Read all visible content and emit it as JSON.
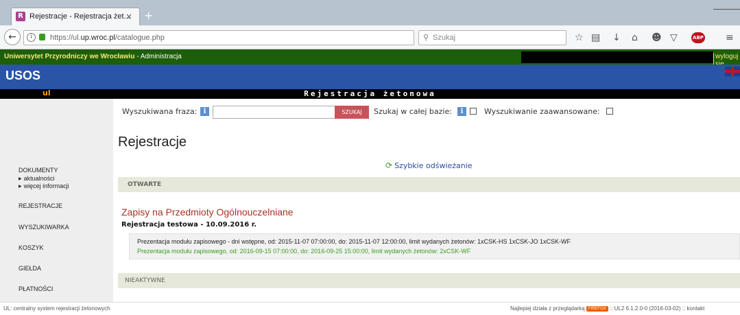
{
  "browser": {
    "tab_title": "Rejestracje - Rejestracja żet...",
    "tab_close": "×",
    "new_tab": "+",
    "favicon_letter": "R",
    "url_prefix": "https://ul.",
    "url_domain": "up.wroc.pl",
    "url_path": "/catalogue.php",
    "search_placeholder": "Szukaj"
  },
  "header": {
    "university": "Uniwersytet Przyrodniczy we Wrocławiu",
    "admin_link": " - Administracja",
    "logout": "wyloguj się",
    "logo": "USOS",
    "logo_sub": "ul",
    "page_banner": "Rejestracja żetonowa"
  },
  "sidebar": {
    "items": [
      {
        "label": "DOKUMENTY"
      },
      {
        "label": "aktualności"
      },
      {
        "label": "więcej informacji"
      },
      {
        "label": "REJESTRACJE"
      },
      {
        "label": "WYSZUKIWARKA"
      },
      {
        "label": "KOSZYK"
      },
      {
        "label": "GIEŁDA"
      },
      {
        "label": "PŁATNOŚCI"
      }
    ]
  },
  "search": {
    "label": "Wyszukiwana fraza:",
    "button": "SZUKAJ",
    "whole_db_label": "Szukaj w całej bazie:",
    "advanced_label": "Wyszukiwanie zaawansowane:",
    "info_glyph": "i"
  },
  "main": {
    "heading": "Rejestracje",
    "refresh_link": "Szybkie odświeżanie",
    "open_section": "OTWARTE",
    "registration_title": "Zapisy na Przedmioty Ogólnouczelniane",
    "registration_subtitle": "Rejestracja testowa - 10.09.2016 r.",
    "round1": "Prezentacja modułu zapisowego - dni wstępne, od: 2015-11-07 07:00:00, do: 2015-11-07 12:00:00, limit wydanych żetonów: 1xCSK-HS 1xCSK-JO 1xCSK-WF",
    "round2": "Prezentacja modułu zapisowego, od: 2016-09-15 07:00:00, do: 2016-09-25 15:00:00, limit wydanych żetonów: 2xCSK-WF",
    "inactive_section": "NIEAKTYWNE"
  },
  "footer": {
    "left": "UL: centralny system rejestracji żetonowych",
    "best_with": "Najlepiej działa z przeglądarką",
    "firefox": "FIREFOX",
    "version": ":: UL2 6.1.2.0-0 (2016-03-02)",
    "contact": ":: kontakt"
  },
  "colors": {
    "univ_bar": "#1c5e0a",
    "usos_bar": "#2a54a5",
    "search_button": "#c9525a",
    "section_bg": "#e6e8d9",
    "registration_title": "#a93226",
    "active_round": "#3a9d23"
  }
}
